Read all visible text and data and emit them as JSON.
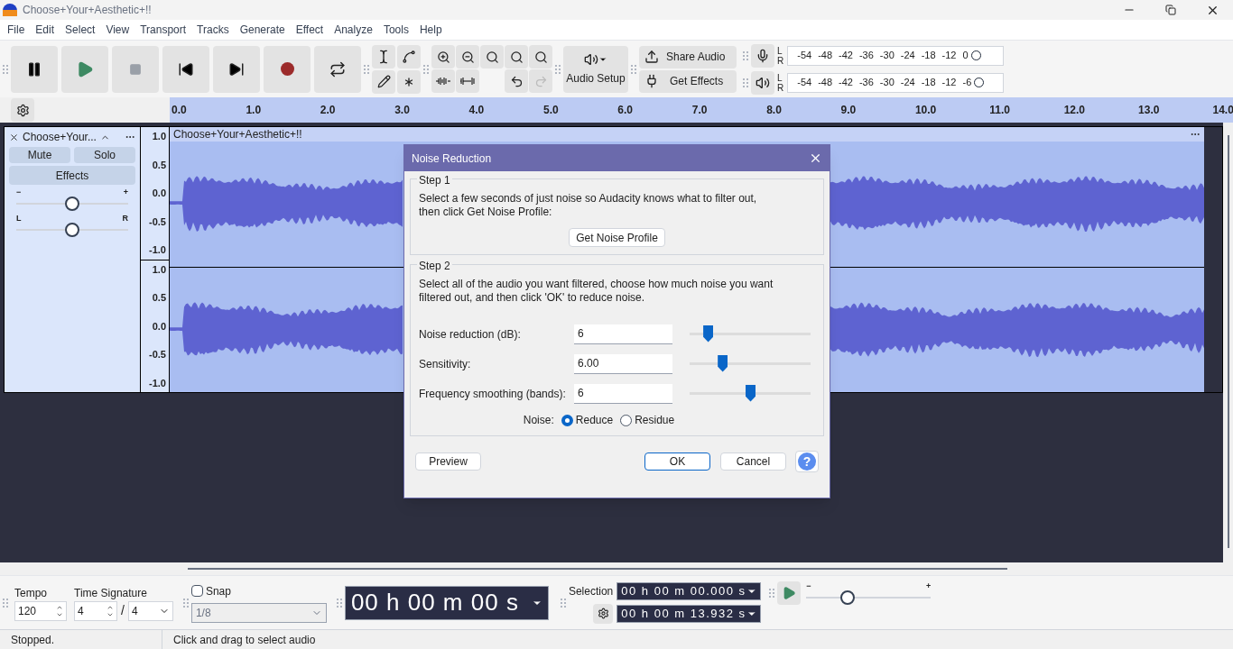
{
  "window": {
    "title": "Choose+Your+Aesthetic+!!"
  },
  "menu": [
    "File",
    "Edit",
    "Select",
    "View",
    "Transport",
    "Tracks",
    "Generate",
    "Effect",
    "Analyze",
    "Tools",
    "Help"
  ],
  "toolbar": {
    "audio_setup": "Audio Setup",
    "share_audio": "Share Audio",
    "get_effects": "Get Effects"
  },
  "meters": [
    {
      "kind": "record",
      "channels": [
        "L",
        "R"
      ],
      "ticks": [
        "-54",
        "-48",
        "-42",
        "-36",
        "-30",
        "-24",
        "-18",
        "-12",
        "0"
      ]
    },
    {
      "kind": "playback",
      "channels": [
        "L",
        "R"
      ],
      "ticks": [
        "-54",
        "-48",
        "-42",
        "-36",
        "-30",
        "-24",
        "-18",
        "-12",
        "-6"
      ]
    }
  ],
  "ruler": {
    "ticks": [
      "0.0",
      "1.0",
      "2.0",
      "3.0",
      "4.0",
      "5.0",
      "6.0",
      "7.0",
      "8.0",
      "9.0",
      "10.0",
      "11.0",
      "12.0",
      "13.0",
      "14.0"
    ]
  },
  "track": {
    "name": "Choose+Your...",
    "mute": "Mute",
    "solo": "Solo",
    "effects": "Effects",
    "gain": {
      "min": "−",
      "max": "+",
      "level": 0.5
    },
    "pan": {
      "min": "L",
      "max": "R",
      "level": 0.5
    },
    "clip_title": "Choose+Your+Aesthetic+!!",
    "channels": [
      {
        "scale": [
          "1.0",
          "0.5",
          "0.0",
          "-0.5",
          "-1.0"
        ]
      },
      {
        "scale": [
          "1.0",
          "0.5",
          "0.0",
          "-0.5",
          "-1.0"
        ]
      }
    ]
  },
  "dialog": {
    "title": "Noise Reduction",
    "step1": {
      "legend": "Step 1",
      "text": "Select a few seconds of just noise so Audacity knows what to filter out,\nthen click Get Noise Profile:",
      "button": "Get Noise Profile"
    },
    "step2": {
      "legend": "Step 2",
      "text": "Select all of the audio you want filtered, choose how much noise you want\nfiltered out, and then click 'OK' to reduce noise.",
      "fields": [
        {
          "label": "Noise reduction (dB):",
          "value": "6",
          "level": 0.15
        },
        {
          "label": "Sensitivity:",
          "value": "6.00",
          "level": 0.27
        },
        {
          "label": "Frequency smoothing (bands):",
          "value": "6",
          "level": 0.5
        }
      ],
      "noise": {
        "label": "Noise:",
        "options": [
          {
            "label": "Reduce",
            "selected": true
          },
          {
            "label": "Residue",
            "selected": false
          }
        ]
      }
    },
    "buttons": {
      "preview": "Preview",
      "ok": "OK",
      "cancel": "Cancel",
      "help": "?"
    }
  },
  "bottom": {
    "tempo": {
      "label": "Tempo",
      "value": "120"
    },
    "time_signature": {
      "label": "Time Signature",
      "numerator": "4",
      "separator": "/",
      "denominator": "4"
    },
    "snap": {
      "label": "Snap",
      "checked": false,
      "value": "1/8"
    },
    "time": "00 h 00 m 00 s",
    "selection": {
      "label": "Selection",
      "start": "00 h 00 m 00.000 s",
      "end": "00 h 00 m 13.932 s"
    },
    "speed": {
      "min": "−",
      "max": "+",
      "level": 0.33
    }
  },
  "status": [
    "Stopped.",
    "Click and drag to select audio"
  ]
}
